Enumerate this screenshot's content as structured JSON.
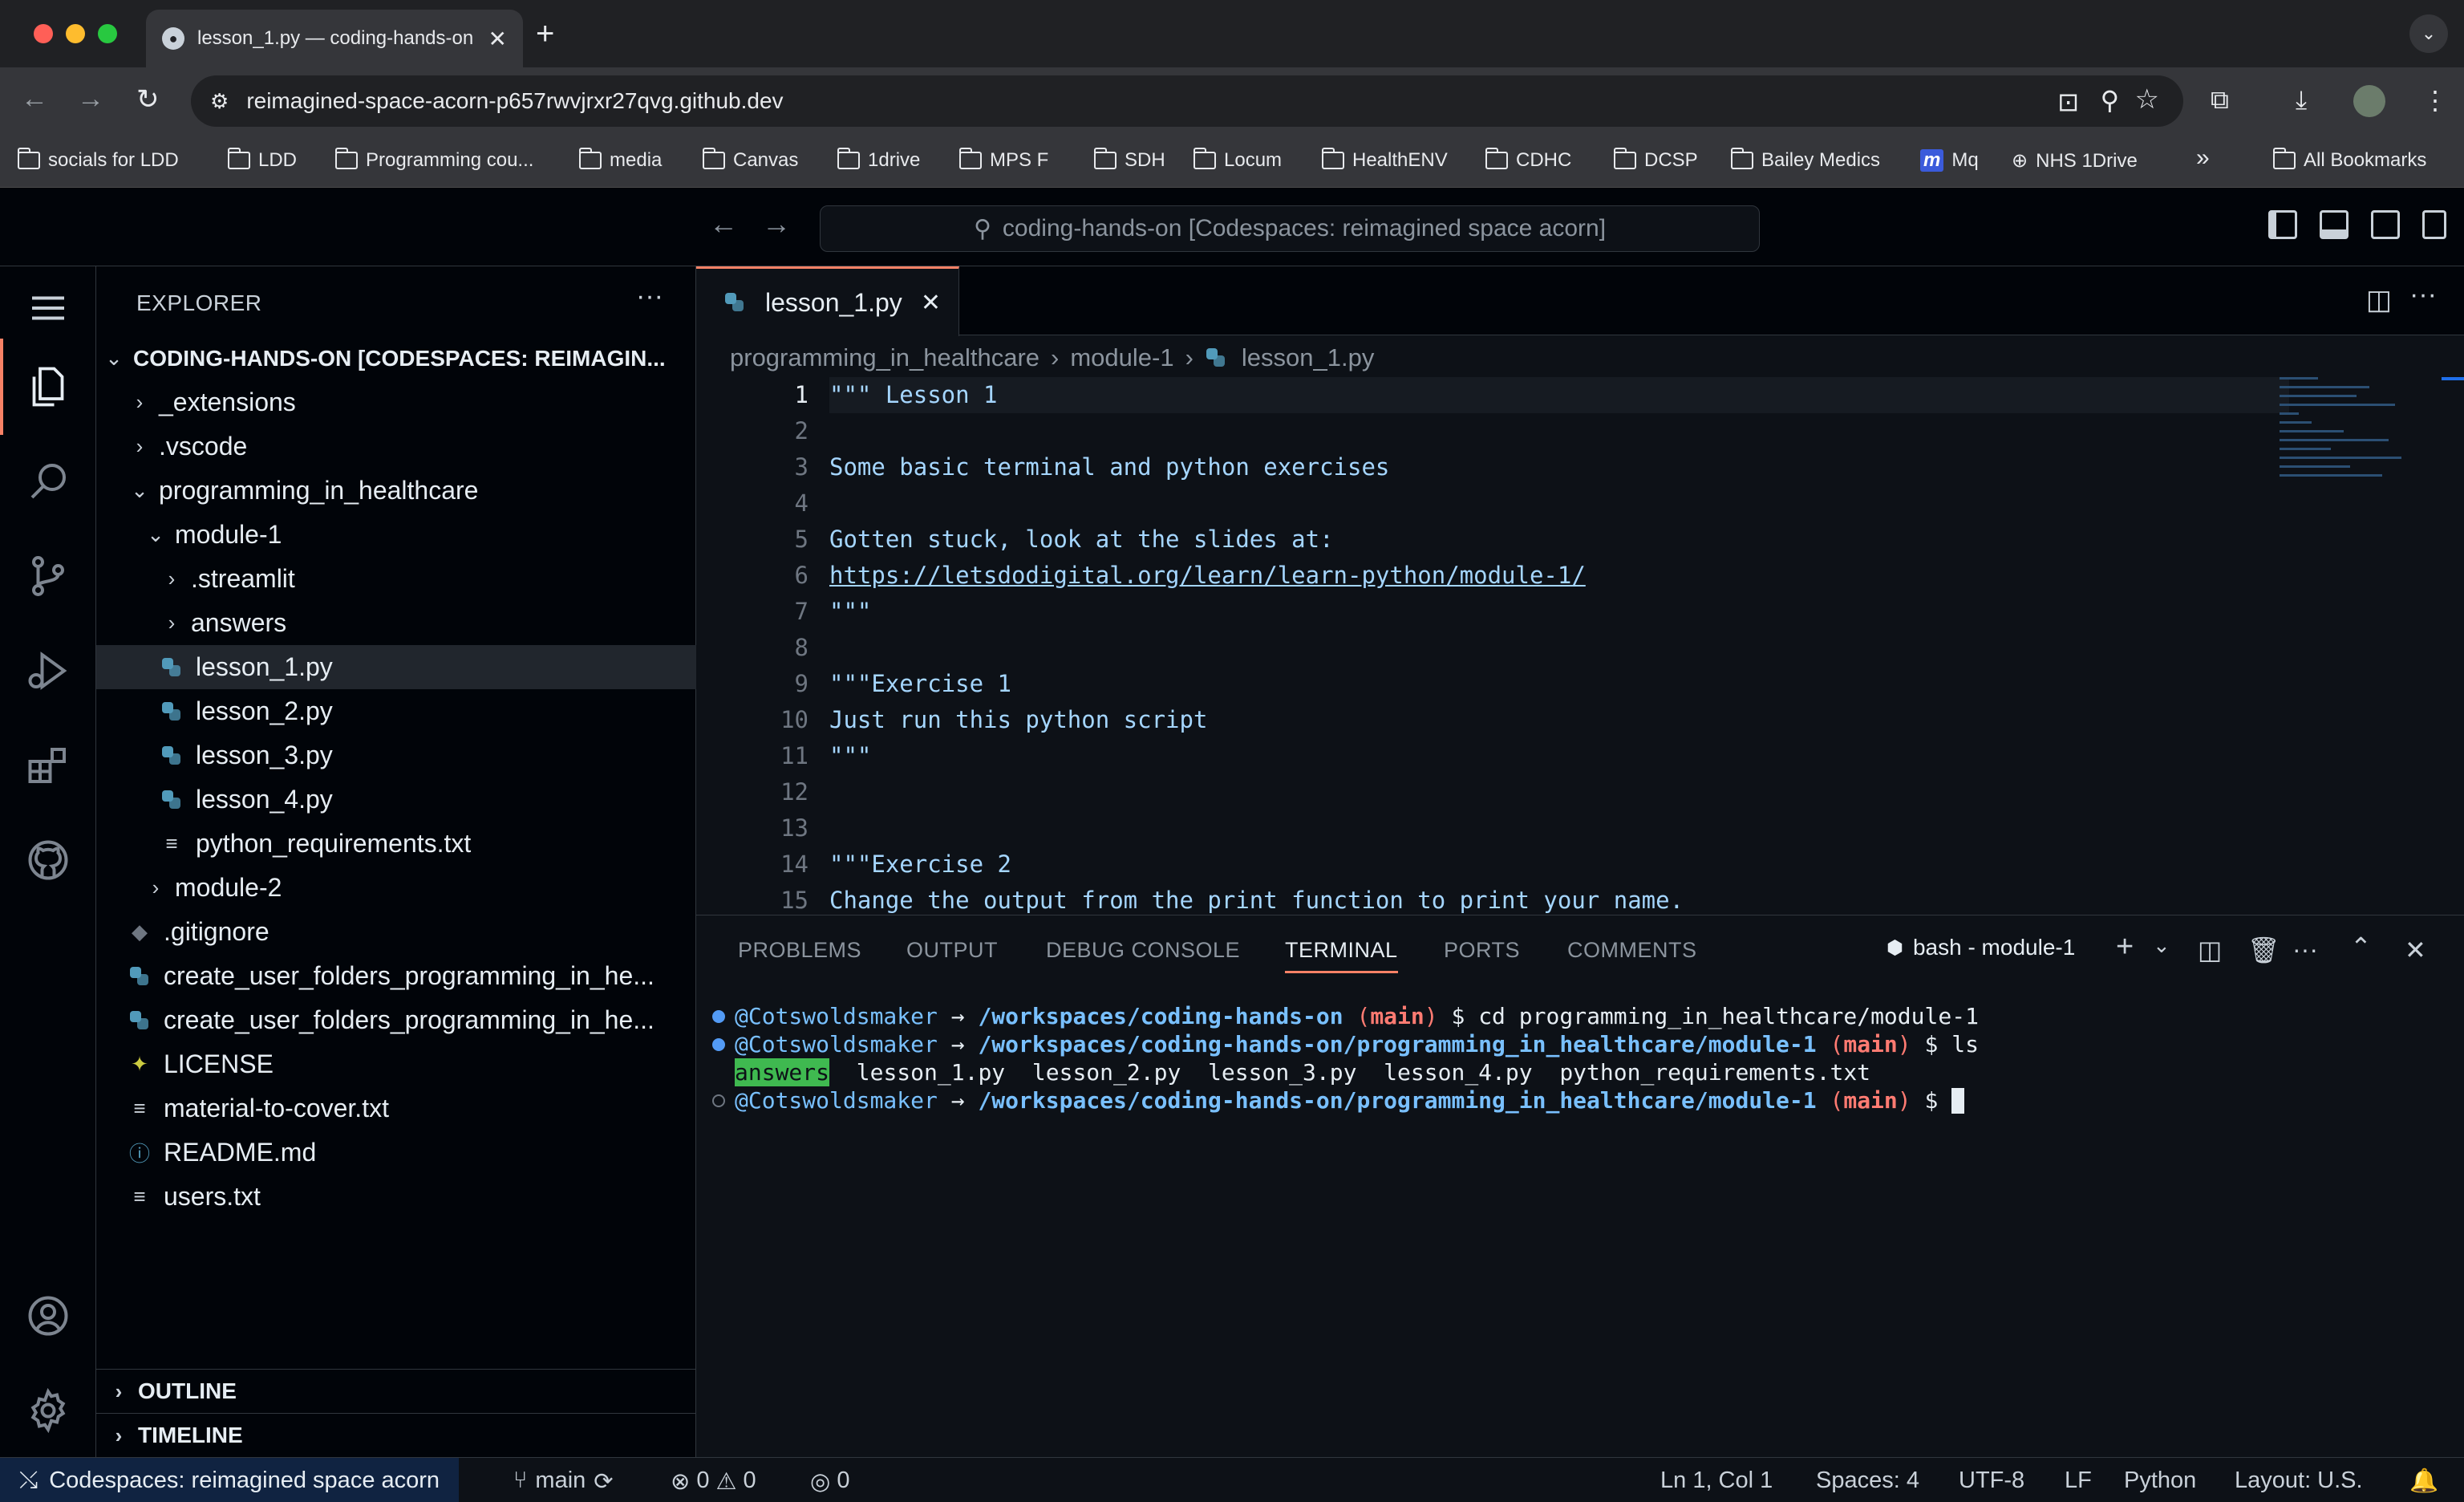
{
  "browser": {
    "tab_title": "lesson_1.py — coding-hands-on",
    "url": "reimagined-space-acorn-p657rwvjrxr27qvg.github.dev",
    "bookmarks": [
      "socials for LDD",
      "LDD",
      "Programming cou...",
      "media",
      "Canvas",
      "1drive",
      "MPS F",
      "SDH",
      "Locum",
      "HealthENV",
      "CDHC",
      "DCSP",
      "Bailey Medics",
      "Mq",
      "NHS 1Drive"
    ],
    "all_bookmarks": "All Bookmarks",
    "overflow": "»"
  },
  "vscode": {
    "command_center": "coding-hands-on [Codespaces: reimagined space acorn]",
    "explorer": {
      "header": "EXPLORER",
      "root": "CODING-HANDS-ON [CODESPACES: REIMAGIN...",
      "items": [
        {
          "label": "_extensions",
          "kind": "folder-closed",
          "depth": 1
        },
        {
          "label": ".vscode",
          "kind": "folder-closed",
          "depth": 1
        },
        {
          "label": "programming_in_healthcare",
          "kind": "folder-open",
          "depth": 1
        },
        {
          "label": "module-1",
          "kind": "folder-open",
          "depth": 2
        },
        {
          "label": ".streamlit",
          "kind": "folder-closed",
          "depth": 3
        },
        {
          "label": "answers",
          "kind": "folder-closed",
          "depth": 3
        },
        {
          "label": "lesson_1.py",
          "kind": "python",
          "depth": 3,
          "selected": true
        },
        {
          "label": "lesson_2.py",
          "kind": "python",
          "depth": 3
        },
        {
          "label": "lesson_3.py",
          "kind": "python",
          "depth": 3
        },
        {
          "label": "lesson_4.py",
          "kind": "python",
          "depth": 3
        },
        {
          "label": "python_requirements.txt",
          "kind": "text",
          "depth": 3
        },
        {
          "label": "module-2",
          "kind": "folder-closed",
          "depth": 2
        },
        {
          "label": ".gitignore",
          "kind": "git",
          "depth": 1
        },
        {
          "label": "create_user_folders_programming_in_he...",
          "kind": "python",
          "depth": 1
        },
        {
          "label": "create_user_folders_programming_in_he...",
          "kind": "python",
          "depth": 1
        },
        {
          "label": "LICENSE",
          "kind": "license",
          "depth": 1
        },
        {
          "label": "material-to-cover.txt",
          "kind": "text",
          "depth": 1
        },
        {
          "label": "README.md",
          "kind": "info",
          "depth": 1
        },
        {
          "label": "users.txt",
          "kind": "text",
          "depth": 1
        }
      ],
      "outline": "OUTLINE",
      "timeline": "TIMELINE"
    },
    "editor": {
      "tab": "lesson_1.py",
      "breadcrumb": [
        "programming_in_healthcare",
        "module-1",
        "lesson_1.py"
      ],
      "lines": [
        "\"\"\" Lesson 1",
        "",
        "Some basic terminal and python exercises",
        "",
        "Gotten stuck, look at the slides at:",
        "https://letsdodigital.org/learn/learn-python/module-1/",
        "\"\"\"",
        "",
        "\"\"\"Exercise 1",
        "Just run this python script",
        "\"\"\"",
        "",
        "",
        "\"\"\"Exercise 2",
        "Change the output from the print function to print your name."
      ],
      "line_numbers": [
        "1",
        "2",
        "3",
        "4",
        "5",
        "6",
        "7",
        "8",
        "9",
        "10",
        "11",
        "12",
        "13",
        "14",
        "15"
      ]
    },
    "panel": {
      "tabs": [
        "PROBLEMS",
        "OUTPUT",
        "DEBUG CONSOLE",
        "TERMINAL",
        "PORTS",
        "COMMENTS"
      ],
      "active_tab": "TERMINAL",
      "terminal_name": "bash - module-1",
      "terminal": {
        "line1": {
          "user": "@Cotswoldsmaker",
          "arrow": "→",
          "path": "/workspaces/coding-hands-on",
          "open": "(",
          "branch": "main",
          "close": ")",
          "prompt": "$",
          "cmd": "cd programming_in_healthcare/module-1"
        },
        "line2": {
          "user": "@Cotswoldsmaker",
          "arrow": "→",
          "path": "/workspaces/coding-hands-on/programming_in_healthcare/module-1",
          "open": "(",
          "branch": "main",
          "close": ")",
          "prompt": "$",
          "cmd": "ls"
        },
        "ls_output": {
          "dir": "answers",
          "files": "lesson_1.py  lesson_2.py  lesson_3.py  lesson_4.py  python_requirements.txt"
        },
        "line4": {
          "user": "@Cotswoldsmaker",
          "arrow": "→",
          "path": "/workspaces/coding-hands-on/programming_in_healthcare/module-1",
          "open": "(",
          "branch": "main",
          "close": ")",
          "prompt": "$"
        }
      }
    },
    "status": {
      "remote": "Codespaces: reimagined space acorn",
      "branch": "main",
      "errors": "0",
      "warnings": "0",
      "ports": "0",
      "position": "Ln 1, Col 1",
      "spaces": "Spaces: 4",
      "encoding": "UTF-8",
      "eol": "LF",
      "language": "Python",
      "layout": "Layout: U.S."
    }
  },
  "colors": {
    "accent": "#f78166",
    "string": "#a5d6ff",
    "branch": "#ff7b72",
    "path": "#79c0ff",
    "dir_bg": "#3fb950"
  }
}
